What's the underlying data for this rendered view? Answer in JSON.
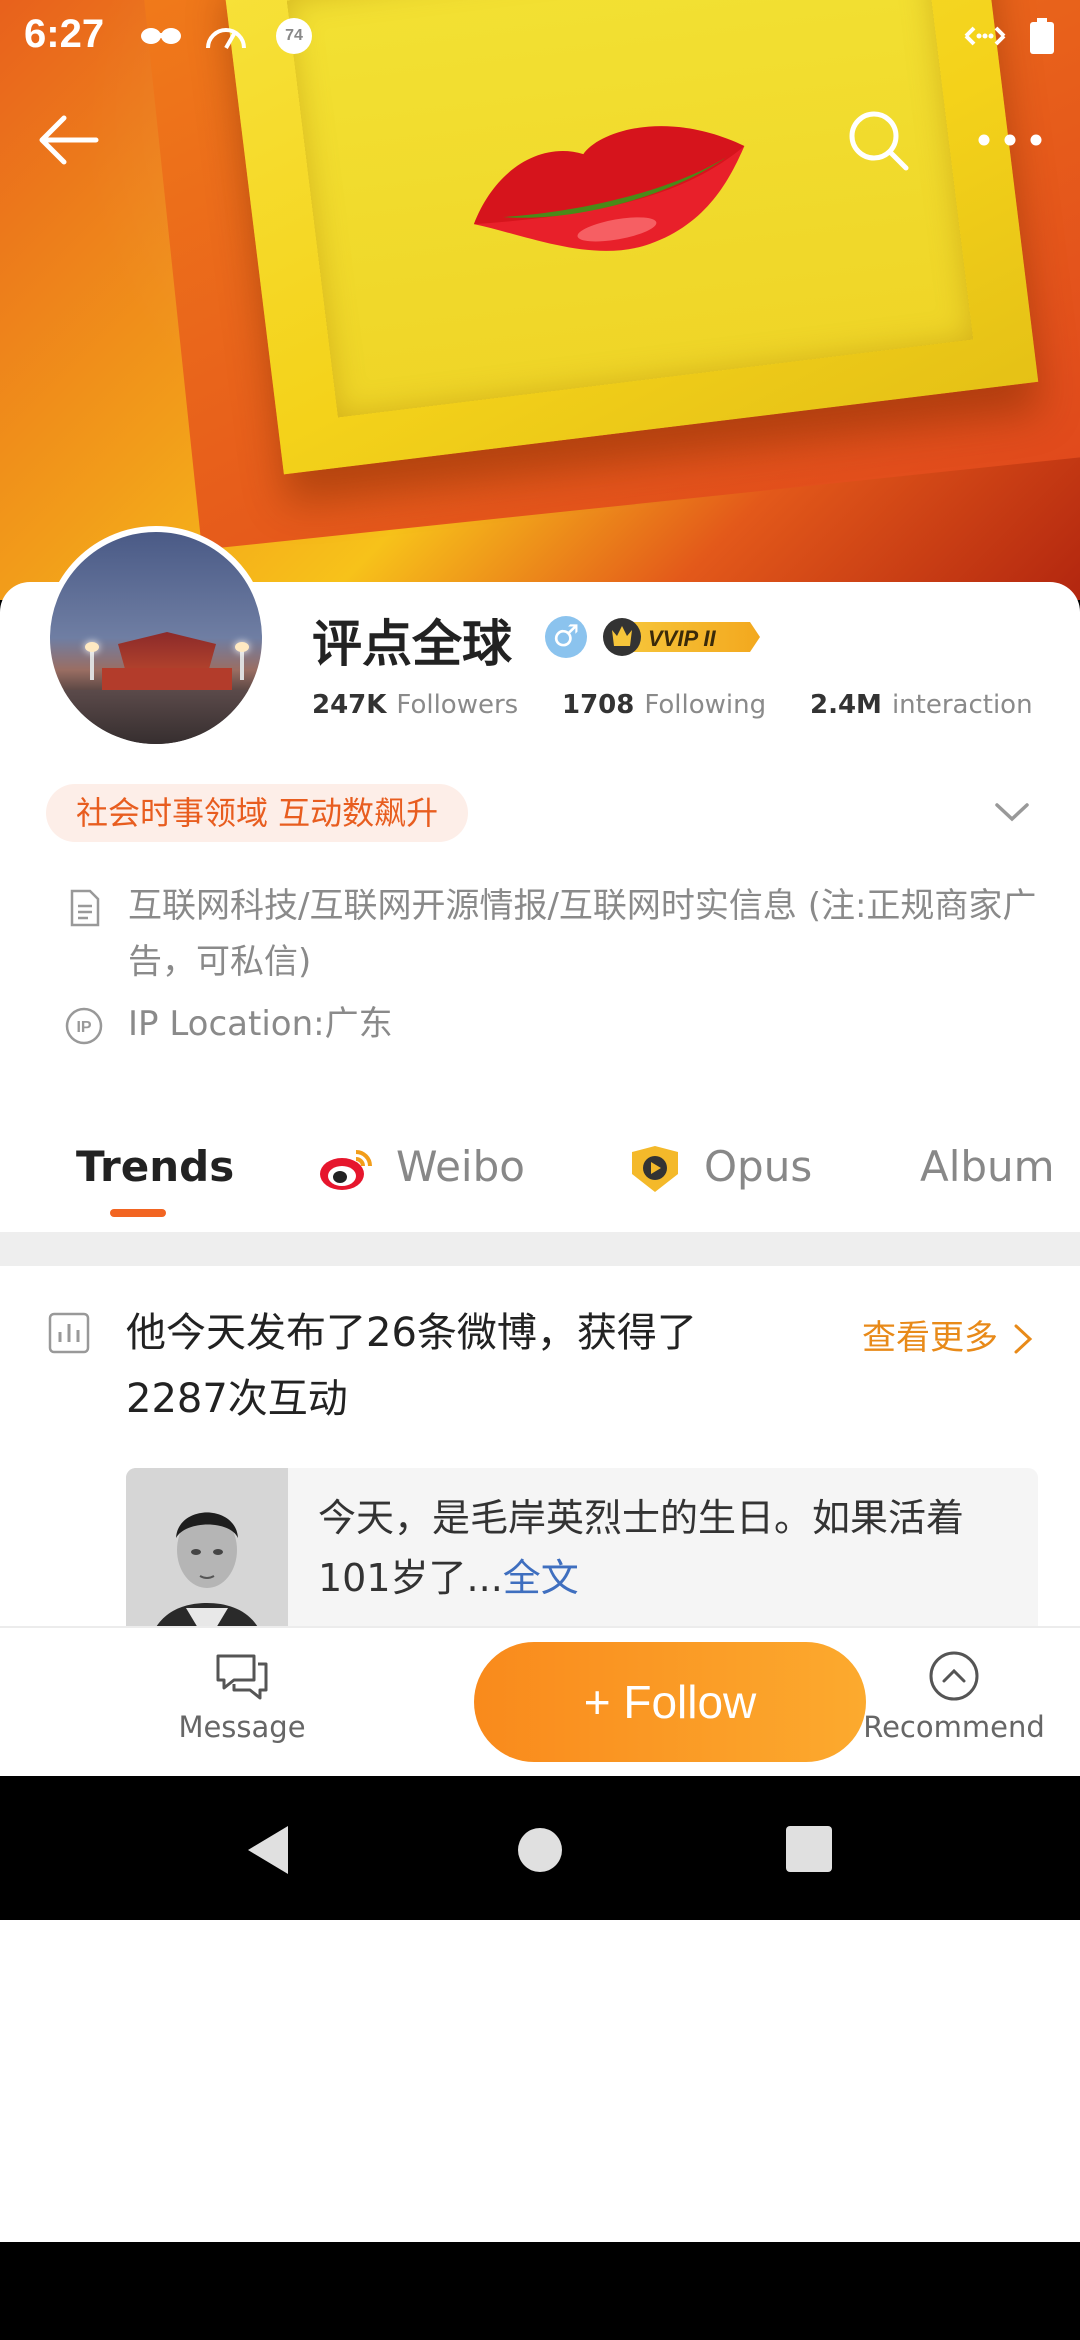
{
  "status_bar": {
    "time": "6:27",
    "battery_badge": "74"
  },
  "profile": {
    "name": "评点全球",
    "vip_label": "VVIP II",
    "stats": [
      {
        "value": "247K",
        "label": "Followers"
      },
      {
        "value": "1708",
        "label": "Following"
      },
      {
        "value": "2.4M",
        "label": "interaction"
      }
    ],
    "tag": "社会时事领域 互动数飙升",
    "bio": "互联网科技/互联网开源情报/互联网时实信息 (注:正规商家广告，可私信)",
    "ip_location": "IP Location:广东"
  },
  "tabs": [
    {
      "label": "Trends"
    },
    {
      "label": "Weibo"
    },
    {
      "label": "Opus"
    },
    {
      "label": "Album"
    }
  ],
  "post": {
    "title": "他今天发布了26条微博，获得了2287次互动",
    "see_more": "查看更多",
    "quote_text": "今天，是毛岸英烈士的生日。如果活着101岁了...",
    "quote_more": "全文"
  },
  "bottom_bar": {
    "message": "Message",
    "follow": "+ Follow",
    "recommend": "Recommend"
  },
  "colors": {
    "accent": "#f26522",
    "follow": "#fb9a24",
    "link": "#3f6fbf"
  }
}
